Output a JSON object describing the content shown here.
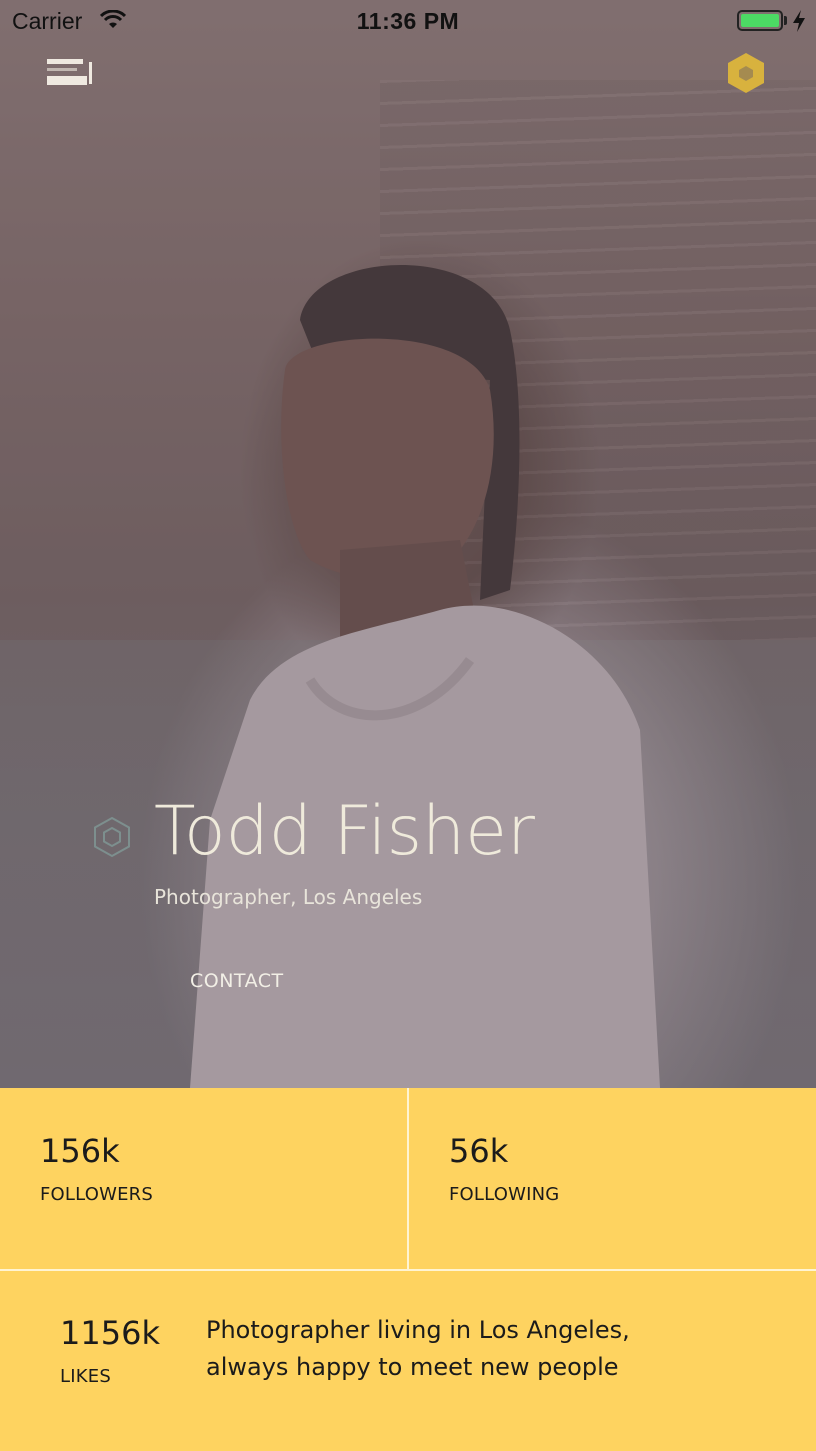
{
  "status_bar": {
    "carrier": "Carrier",
    "time": "11:36 PM",
    "battery_color": "#4cd964"
  },
  "nav": {
    "menu_icon": "menu-icon",
    "settings_icon": "hexagon-icon",
    "accent_color": "#d8b23e"
  },
  "profile": {
    "name": "Todd Fisher",
    "subtitle": "Photographer, Los Angeles",
    "contact_label": "CONTACT",
    "hex_icon": "hexagon-outline-icon"
  },
  "stats": {
    "background": "#fed360",
    "followers": {
      "value": "156k",
      "label": "FOLLOWERS"
    },
    "following": {
      "value": "56k",
      "label": "FOLLOWING"
    },
    "likes": {
      "value": "1156k",
      "label": "LIKES"
    }
  },
  "bio": {
    "line1": "Photographer living in Los Angeles,",
    "line2": "always happy to meet new people"
  }
}
